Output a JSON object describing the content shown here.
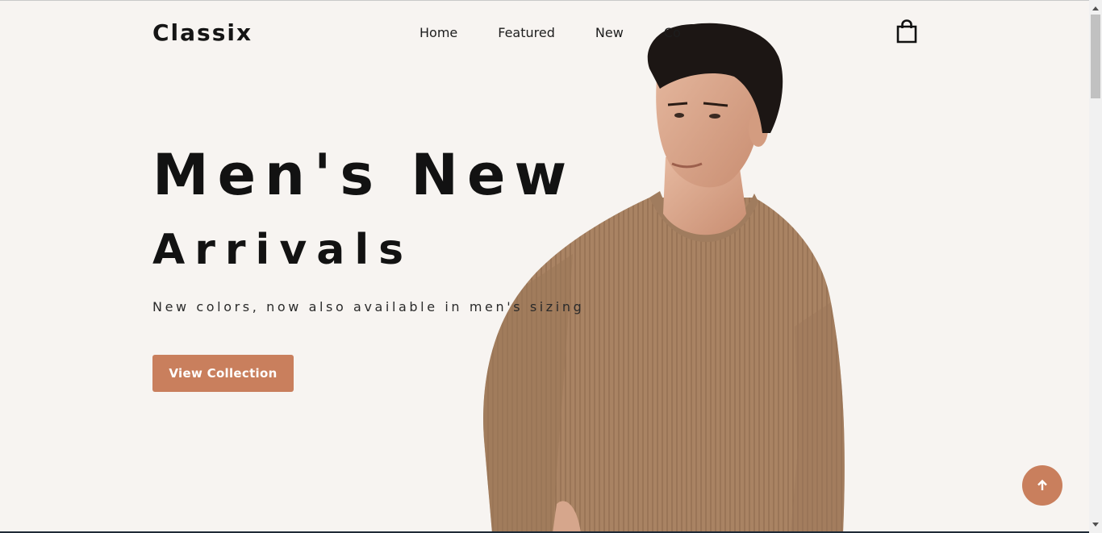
{
  "header": {
    "logo": "Classix",
    "nav": [
      "Home",
      "Featured",
      "New",
      "Co"
    ]
  },
  "hero": {
    "title_line1": "Men's New",
    "title_line2": "Arrivals",
    "subtitle": "New colors, now also available in men's sizing",
    "cta_label": "View Collection"
  },
  "icons": {
    "cart": "shopping-bag-icon",
    "scroll_top": "arrow-up-icon"
  },
  "colors": {
    "accent": "#c97f5d",
    "background": "#f7f4f1",
    "text": "#121212"
  }
}
